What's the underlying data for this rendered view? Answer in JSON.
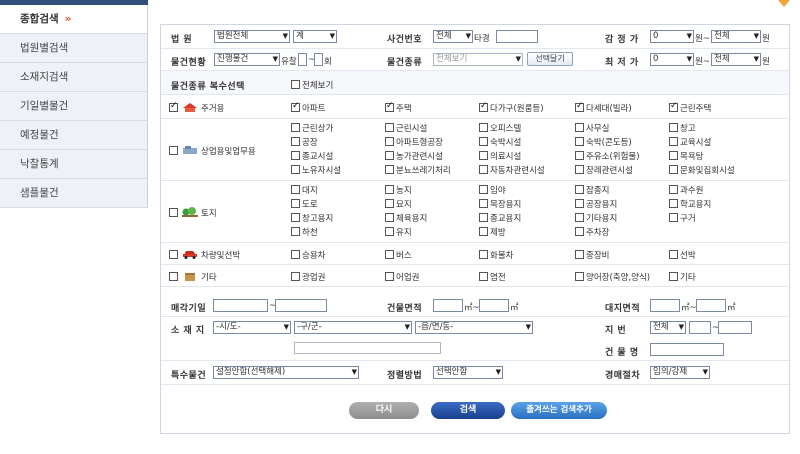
{
  "sidebar": {
    "items": [
      {
        "label": "종합검색",
        "arrow": "»"
      },
      {
        "label": "법원별검색"
      },
      {
        "label": "소재지검색"
      },
      {
        "label": "기일별물건"
      },
      {
        "label": "예정물건"
      },
      {
        "label": "낙찰통계"
      },
      {
        "label": "샘플물건"
      }
    ]
  },
  "form": {
    "court": {
      "label": "법    원",
      "court_value": "법원전체",
      "branch_value": "계"
    },
    "case_no": {
      "label": "사건번호",
      "year_value": "전체",
      "suffix": "타경"
    },
    "appraisal": {
      "label": "감 정 가",
      "min": "0",
      "unit1": "원~",
      "max": "전체",
      "unit2": "원"
    },
    "status": {
      "label": "물건현황",
      "value": "진행물건",
      "fail_label": "유찰",
      "fail_tilde": "~",
      "fail_unit": "회"
    },
    "kind": {
      "label": "물건종류",
      "value": "전체보기",
      "button": "선택달기"
    },
    "lowest": {
      "label": "최 저 가",
      "min": "0",
      "unit1": "원~",
      "max": "전체",
      "unit2": "원"
    },
    "multi": {
      "label": "물건종류 복수선택",
      "view_all": "전체보기"
    },
    "categories": {
      "residential": {
        "label": "주거용",
        "items": [
          "아파트",
          "주택",
          "다가구(원룸등)",
          "다세대(빌라)",
          "근린주택"
        ]
      },
      "commercial": {
        "label": "상업용및업무용",
        "items": [
          "근린상가",
          "근린시설",
          "오피스텔",
          "사무실",
          "창고",
          "공장",
          "아파트형공장",
          "숙박시설",
          "숙박(콘도등)",
          "교육시설",
          "종교시설",
          "농가관련시설",
          "의료시설",
          "주유소(위험물)",
          "목욕탕",
          "노유자시설",
          "분뇨쓰레기처리",
          "자동차관련시설",
          "장례관련시설",
          "문화및집회시설"
        ]
      },
      "land": {
        "label": "토지",
        "items": [
          "대지",
          "농지",
          "임야",
          "잡종지",
          "과수원",
          "도로",
          "묘지",
          "목장용지",
          "공장용지",
          "학교용지",
          "창고용지",
          "체육용지",
          "종교용지",
          "기타용지",
          "구거",
          "하천",
          "유지",
          "제방",
          "주차장"
        ]
      },
      "vehicle": {
        "label": "차량및선박",
        "items": [
          "승용차",
          "버스",
          "화물차",
          "중장비",
          "선박"
        ]
      },
      "etc": {
        "label": "기타",
        "items": [
          "광업권",
          "어업권",
          "염전",
          "양어장(축양,양식)",
          "기타"
        ]
      }
    },
    "sale_date": {
      "label": "매각기일",
      "tilde": "~"
    },
    "bldg_area": {
      "label": "건물면적",
      "unit1": "㎡~",
      "unit2": "㎡"
    },
    "land_area": {
      "label": "대지면적",
      "unit1": "㎡~",
      "unit2": "㎡"
    },
    "location": {
      "label": "소 재 지",
      "sido": "-시/도-",
      "gugun": "-구/군-",
      "dong": "-읍/면/동-"
    },
    "lot": {
      "label": "지    번",
      "value": "전체",
      "tilde": "~"
    },
    "bldg_name": {
      "label": "건 물 명"
    },
    "special": {
      "label": "특수물건",
      "value": "설정안함(선택해제)"
    },
    "sort": {
      "label": "정렬방법",
      "value": "선택안함"
    },
    "procedure": {
      "label": "경매절차",
      "value": "임의/강제"
    },
    "buttons": {
      "reset": "다시",
      "search": "검색",
      "favorite": "즐겨쓰는 검색추가"
    }
  },
  "colors": {
    "sidebar_top": "#2f4f7f",
    "search_button": "#1e4fa8",
    "favorite_button": "#3a84d6",
    "reset_button": "#9a9a9a",
    "accent_arrow": "#e8502e"
  }
}
